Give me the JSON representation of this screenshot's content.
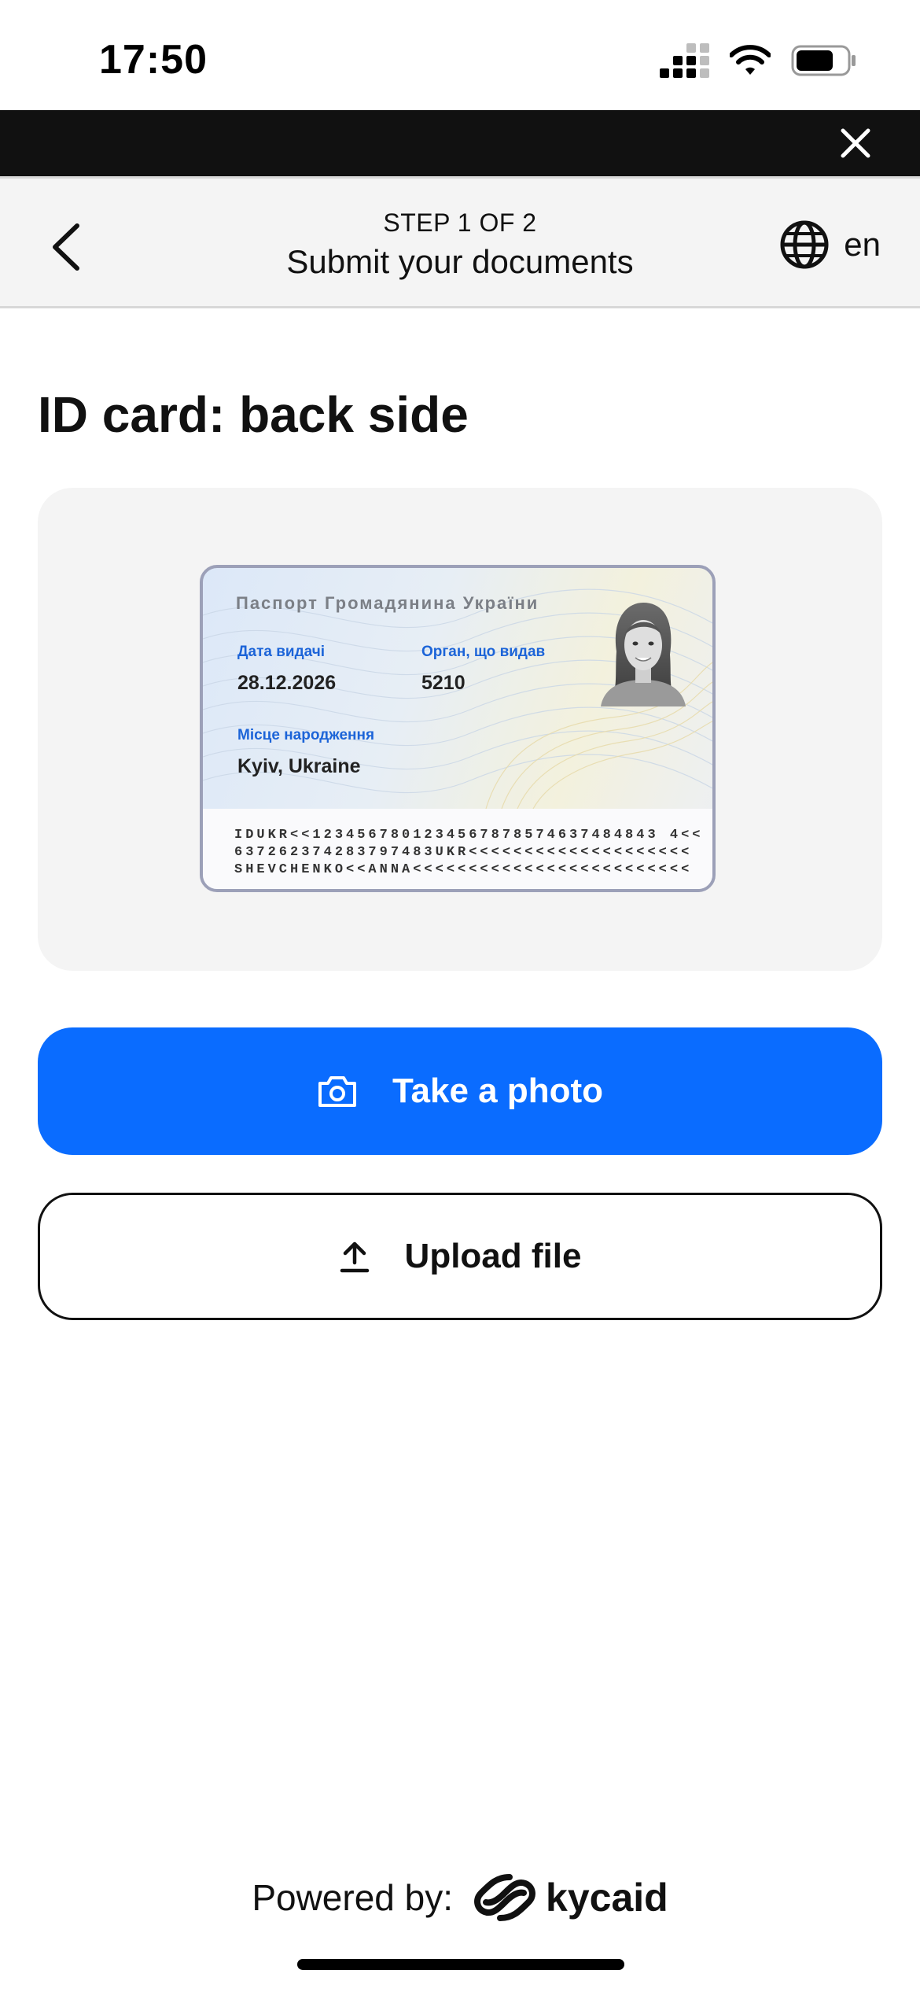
{
  "status_bar": {
    "time": "17:50",
    "icons": [
      "cellular-signal-icon",
      "wifi-icon",
      "battery-icon"
    ]
  },
  "top_bar": {
    "close_icon": "close-icon"
  },
  "header": {
    "step_label": "STEP 1 OF 2",
    "title": "Submit your documents",
    "language": "en",
    "back_icon": "chevron-left-icon",
    "language_icon": "globe-icon"
  },
  "page": {
    "title": "ID card: back side"
  },
  "id_card": {
    "heading": "Паспорт Громадянина України",
    "fields": [
      {
        "label": "Дата видачі",
        "value": "28.12.2026"
      },
      {
        "label": "Орган, що видав",
        "value": "5210"
      },
      {
        "label": "Місце народження",
        "value": "Kyiv, Ukraine"
      }
    ],
    "mrz": [
      "IDUKR<<1234567801234567878574637484843 4<<",
      "637262374283797483UKR<<<<<<<<<<<<<<<<<<<<",
      "SHEVCHENKO<<ANNA<<<<<<<<<<<<<<<<<<<<<<<<<"
    ]
  },
  "actions": {
    "take_photo": "Take a photo",
    "upload_file": "Upload file"
  },
  "footer": {
    "powered_by": "Powered by:",
    "brand": "kycaid"
  },
  "colors": {
    "primary": "#0a6cff",
    "panel": "#f4f4f4",
    "header_bg": "#f4f4f4",
    "top_bar": "#111111",
    "card_label": "#1c64d8"
  }
}
